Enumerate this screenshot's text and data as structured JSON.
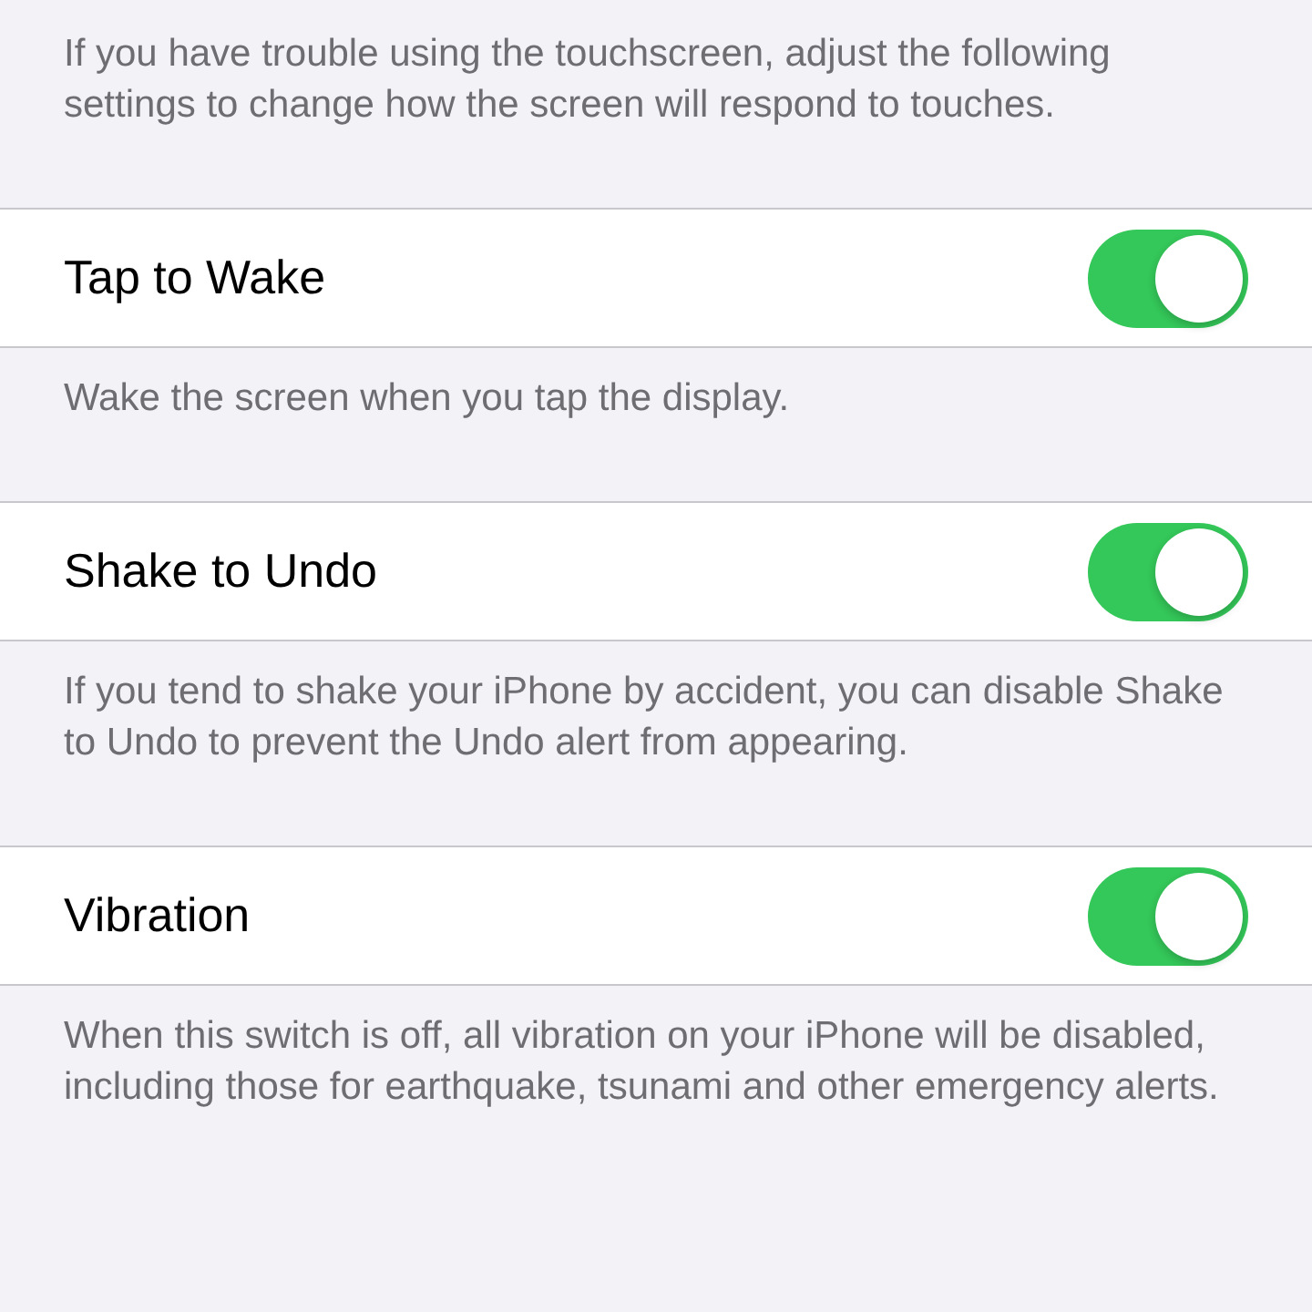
{
  "intro": "If you have trouble using the touchscreen, adjust the following settings to change how the screen will respond to touches.",
  "settings": [
    {
      "label": "Tap to Wake",
      "on": true,
      "footer": "Wake the screen when you tap the display."
    },
    {
      "label": "Shake to Undo",
      "on": true,
      "footer": "If you tend to shake your iPhone by accident, you can disable Shake to Undo to prevent the Undo alert from appearing."
    },
    {
      "label": "Vibration",
      "on": true,
      "footer": "When this switch is off, all vibration on your iPhone will be disabled, including those for earthquake, tsunami and other emergency alerts."
    }
  ]
}
